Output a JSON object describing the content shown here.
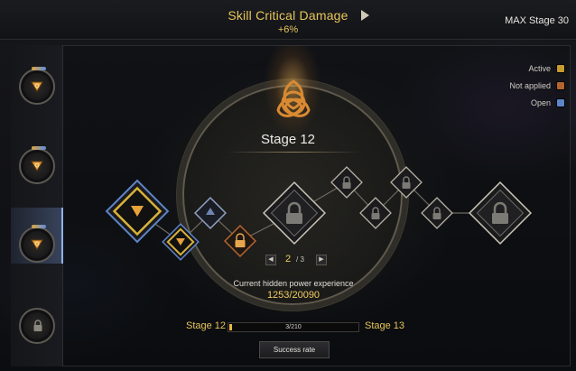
{
  "header": {
    "title": "Skill Critical Damage",
    "subtitle": "+6%",
    "max_stage": "MAX Stage 30"
  },
  "legend": [
    {
      "label": "Active",
      "color": "#c79b2e"
    },
    {
      "label": "Not applied",
      "color": "#b2642f"
    },
    {
      "label": "Open",
      "color": "#5d84c8"
    }
  ],
  "colors": {
    "accent_gold": "#e7c55a",
    "selected_blue": "#8fb0e6"
  },
  "sidebar": {
    "slots": [
      {
        "icon": "triquetra-icon",
        "state": "active"
      },
      {
        "icon": "triquetra-icon",
        "state": "active"
      },
      {
        "icon": "triquetra-icon",
        "state": "selected"
      },
      {
        "icon": "lock-icon",
        "state": "locked"
      }
    ]
  },
  "center": {
    "emblem_icon": "triquetra-emblem-icon",
    "stage_title": "Stage 12",
    "page_current": "2",
    "page_total": "/ 3",
    "exp_label": "Current hidden power experience",
    "exp_value": "1253/20090"
  },
  "nodes": [
    {
      "state": "active"
    },
    {
      "state": "active"
    },
    {
      "state": "open"
    },
    {
      "state": "not-applied"
    },
    {
      "state": "locked"
    },
    {
      "state": "locked"
    },
    {
      "state": "locked"
    },
    {
      "state": "locked"
    },
    {
      "state": "locked"
    },
    {
      "state": "locked"
    }
  ],
  "progress": {
    "left_label": "Stage 12",
    "right_label": "Stage 13",
    "text": "3/210",
    "value": 3,
    "max": 210
  },
  "buttons": {
    "success_rate": "Success rate"
  }
}
